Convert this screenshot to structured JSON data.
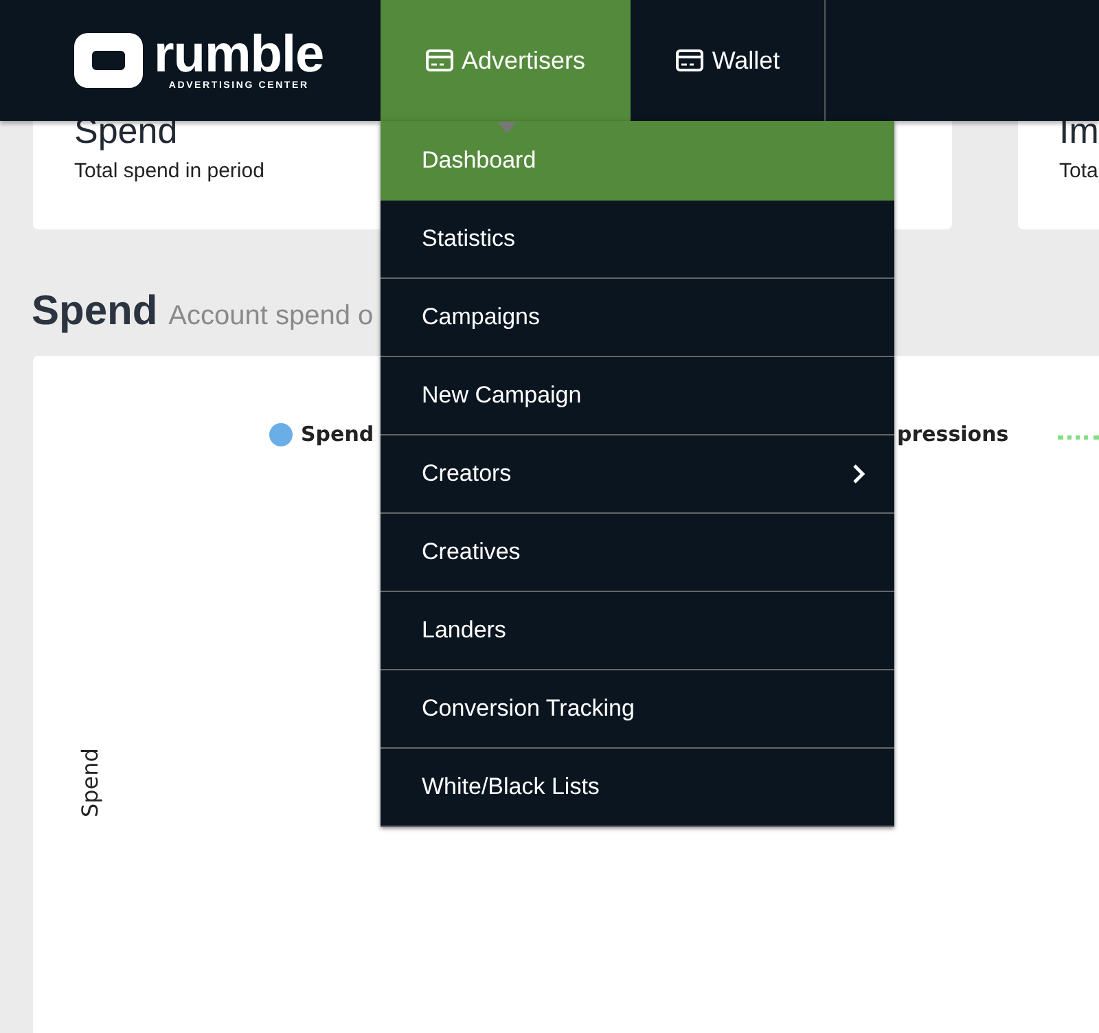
{
  "header": {
    "logo": {
      "name": "rumble",
      "tagline": "ADVERTISING CENTER"
    },
    "nav": [
      {
        "label": "Advertisers",
        "selected": true
      },
      {
        "label": "Wallet",
        "selected": false
      }
    ]
  },
  "cards": [
    {
      "title": "Spend",
      "subtitle": "Total spend in period"
    },
    {
      "title": "Im",
      "subtitle": "Tota"
    }
  ],
  "section": {
    "title": "Spend",
    "subtitle": "Account spend o"
  },
  "chart": {
    "legend": [
      {
        "label": "Spend",
        "color": "#6aaee8",
        "kind": "dot"
      },
      {
        "label": "pressions",
        "kind": "text"
      },
      {
        "color": "#7ee07e",
        "kind": "dotted"
      }
    ],
    "ylabel": "Spend"
  },
  "menu": {
    "items": [
      {
        "label": "Dashboard",
        "selected": true,
        "submenu": false
      },
      {
        "label": "Statistics",
        "selected": false,
        "submenu": false
      },
      {
        "label": "Campaigns",
        "selected": false,
        "submenu": false
      },
      {
        "label": "New Campaign",
        "selected": false,
        "submenu": false
      },
      {
        "label": "Creators",
        "selected": false,
        "submenu": true
      },
      {
        "label": "Creatives",
        "selected": false,
        "submenu": false
      },
      {
        "label": "Landers",
        "selected": false,
        "submenu": false
      },
      {
        "label": "Conversion Tracking",
        "selected": false,
        "submenu": false
      },
      {
        "label": "White/Black Lists",
        "selected": false,
        "submenu": false
      }
    ]
  }
}
